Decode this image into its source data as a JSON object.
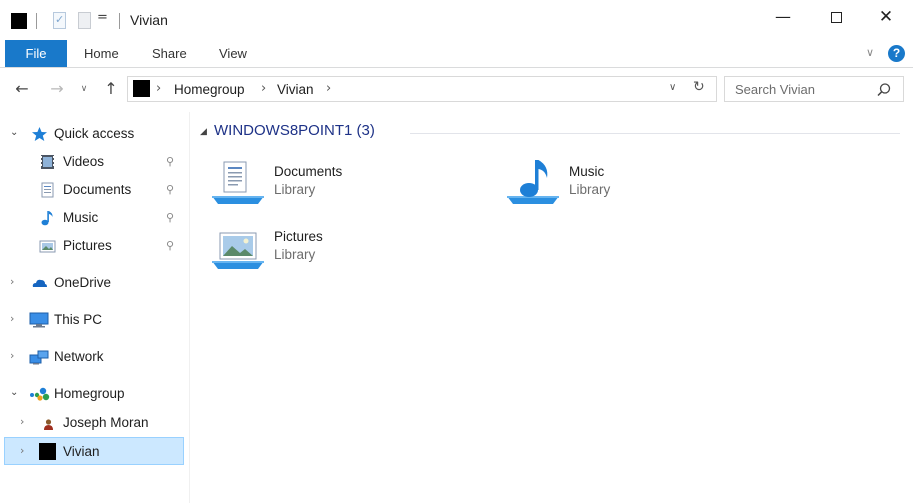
{
  "window": {
    "title": "Vivian",
    "qat_dropdown": "=",
    "minimize": "—",
    "close": "✕"
  },
  "ribbon": {
    "tabs": {
      "file": "File",
      "home": "Home",
      "share": "Share",
      "view": "View"
    },
    "expand": "∨",
    "help": "?"
  },
  "nav": {
    "back": "←",
    "forward": "→",
    "recent": "∨",
    "up": "↑"
  },
  "address": {
    "breadcrumbs": [
      "Homegroup",
      "Vivian"
    ],
    "separator": "›",
    "dropdown": "∨",
    "refresh": "↻"
  },
  "search": {
    "placeholder": "Search Vivian"
  },
  "sidebar": {
    "quick_access": "Quick access",
    "pinned": [
      {
        "label": "Videos",
        "icon": "videos-icon"
      },
      {
        "label": "Documents",
        "icon": "documents-icon"
      },
      {
        "label": "Music",
        "icon": "music-icon"
      },
      {
        "label": "Pictures",
        "icon": "pictures-icon"
      }
    ],
    "pin_glyph": "📌",
    "onedrive": "OneDrive",
    "this_pc": "This PC",
    "network": "Network",
    "homegroup": "Homegroup",
    "homegroup_members": [
      "Joseph Moran",
      "Vivian"
    ],
    "expanded_chevron": "⌄",
    "collapsed_chevron": "›"
  },
  "content": {
    "group_title": "WINDOWS8POINT1 (3)",
    "group_arrow": "◢",
    "libraries": [
      {
        "name": "Documents",
        "type": "Library",
        "icon": "documents-library-icon"
      },
      {
        "name": "Music",
        "type": "Library",
        "icon": "music-library-icon"
      },
      {
        "name": "Pictures",
        "type": "Library",
        "icon": "pictures-library-icon"
      }
    ]
  },
  "colors": {
    "accent": "#1979ca",
    "selection_bg": "#cce8ff",
    "selection_border": "#99d1ff",
    "group_title": "#1e3287"
  }
}
